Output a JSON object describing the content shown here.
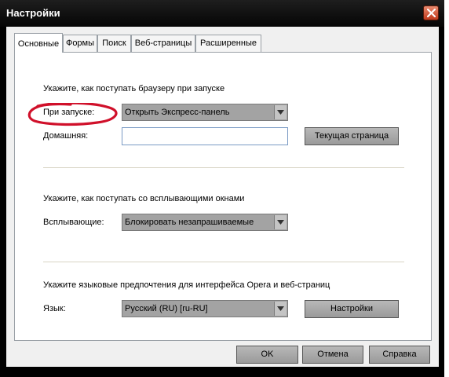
{
  "window": {
    "title": "Настройки"
  },
  "tabs": [
    {
      "label": "Основные",
      "active": true
    },
    {
      "label": "Формы",
      "active": false
    },
    {
      "label": "Поиск",
      "active": false
    },
    {
      "label": "Веб-страницы",
      "active": false
    },
    {
      "label": "Расширенные",
      "active": false
    }
  ],
  "startup": {
    "heading": "Укажите, как поступать браузеру при запуске",
    "label": "При запуске:",
    "value": "Открыть Экспресс-панель",
    "home_label": "Домашняя:",
    "home_value": "",
    "current_page_button": "Текущая страница"
  },
  "popups": {
    "heading": "Укажите, как поступать со всплывающими окнами",
    "label": "Всплывающие:",
    "value": "Блокировать незапрашиваемые"
  },
  "language": {
    "heading": "Укажите языковые предпочтения для интерфейса Opera и веб-страниц",
    "label": "Язык:",
    "value": "Русский (RU) [ru-RU]",
    "settings_button": "Настройки"
  },
  "buttons": {
    "ok": "OK",
    "cancel": "Отмена",
    "help": "Справка"
  },
  "colors": {
    "titlebar": "#0a0a0a",
    "dialog_bg": "#f0f0f0",
    "close_button": "#c0391c",
    "annotation": "#d0102a"
  }
}
